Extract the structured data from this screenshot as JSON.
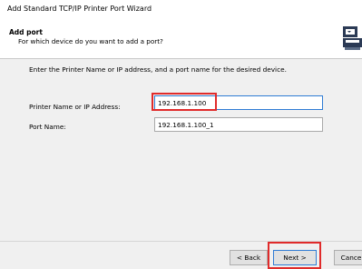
{
  "window": {
    "title": "Add Standard TCP/IP Printer Port Wizard"
  },
  "header": {
    "heading": "Add port",
    "subheading": "For which device do you want to add a port?",
    "icon": "printer-network-icon"
  },
  "content": {
    "instructions": "Enter the Printer Name or IP address, and a port name for the desired device.",
    "printer_name_label": "Printer Name or IP Address:",
    "printer_name_value": "192.168.1.100",
    "port_name_label": "Port Name:",
    "port_name_value": "192.168.1.100_1"
  },
  "footer": {
    "back_label": "< Back",
    "next_label": "Next >",
    "cancel_label": "Cancel"
  },
  "colors": {
    "highlight": "#e02b2b",
    "focus_border": "#2f7cd4",
    "panel_background": "#f0f0f0"
  }
}
